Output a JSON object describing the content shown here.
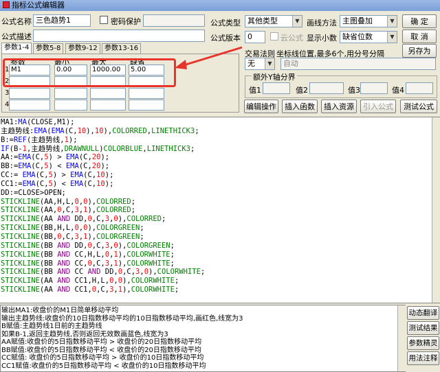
{
  "window": {
    "title": "指标公式编辑器"
  },
  "form": {
    "name_label": "公式名称",
    "name_value": "三色趋势1",
    "password_label": "密码保护",
    "desc_label": "公式描述",
    "type_label": "公式类型",
    "type_value": "其他类型",
    "draw_label": "画线方法",
    "draw_value": "主图叠加",
    "version_label": "公式版本",
    "version_value": "0",
    "cloud_label": "云公式",
    "decimals_label": "显示小数",
    "decimals_value": "缺省位数",
    "trade_label": "交易法则",
    "coord_label": "坐标线位置,最多6个,用分号分隔",
    "trade_value": "无",
    "coord_value": "自动"
  },
  "buttons": {
    "ok": "确 定",
    "cancel": "取 消",
    "save_as": "另存为",
    "edit_op": "编辑操作",
    "insert_fn": "插入函数",
    "insert_res": "插入资源",
    "import": "引入公式",
    "test": "测试公式"
  },
  "param_tabs": [
    "参数1-4",
    "参数5-8",
    "参数9-12",
    "参数13-16"
  ],
  "param_headers": [
    "参数",
    "最小",
    "最大",
    "缺省"
  ],
  "params": [
    {
      "row": "1",
      "name": "M1",
      "min": "0.00",
      "max": "1000.00",
      "def": "5.00"
    },
    {
      "row": "2",
      "name": "",
      "min": "",
      "max": "",
      "def": ""
    },
    {
      "row": "3",
      "name": "",
      "min": "",
      "max": "",
      "def": ""
    },
    {
      "row": "4",
      "name": "",
      "min": "",
      "max": "",
      "def": ""
    }
  ],
  "y_axis": {
    "title": "额外Y轴分界",
    "labels": [
      "值1",
      "值2",
      "值3",
      "值4"
    ]
  },
  "code_lines": [
    [
      [
        "MA1:",
        "op"
      ],
      [
        "MA",
        "fn"
      ],
      [
        "(CLOSE,M1);",
        "op"
      ]
    ],
    [
      [
        "主趋势线:",
        "op"
      ],
      [
        "EMA",
        "fn"
      ],
      [
        "(",
        "op"
      ],
      [
        "EMA",
        "fn"
      ],
      [
        "(C,",
        "op"
      ],
      [
        "10",
        "num"
      ],
      [
        "),",
        "op"
      ],
      [
        "10",
        "num"
      ],
      [
        "),",
        "op"
      ],
      [
        "COLORRED",
        "color"
      ],
      [
        ",",
        "op"
      ],
      [
        "LINETHICK3",
        "color"
      ],
      [
        ";",
        "op"
      ]
    ],
    [
      [
        "B:=",
        "op"
      ],
      [
        "REF",
        "fn"
      ],
      [
        "(主趋势线,",
        "op"
      ],
      [
        "1",
        "num"
      ],
      [
        ");",
        "op"
      ]
    ],
    [
      [
        "IF",
        "fn"
      ],
      [
        "(B-",
        "op"
      ],
      [
        "1",
        "num"
      ],
      [
        ",主趋势线,",
        "op"
      ],
      [
        "DRAWNULL",
        "color"
      ],
      [
        ")",
        "op"
      ],
      [
        "COLORBLUE",
        "color"
      ],
      [
        ",",
        "op"
      ],
      [
        "LINETHICK3",
        "color"
      ],
      [
        ";",
        "op"
      ]
    ],
    [
      [
        "AA:=",
        "op"
      ],
      [
        "EMA",
        "fn"
      ],
      [
        "(C,",
        "op"
      ],
      [
        "5",
        "num"
      ],
      [
        ") > ",
        "op"
      ],
      [
        "EMA",
        "fn"
      ],
      [
        "(C,",
        "op"
      ],
      [
        "20",
        "num"
      ],
      [
        ");",
        "op"
      ]
    ],
    [
      [
        "BB:=",
        "op"
      ],
      [
        "EMA",
        "fn"
      ],
      [
        "(C,",
        "op"
      ],
      [
        "5",
        "num"
      ],
      [
        ") < ",
        "op"
      ],
      [
        "EMA",
        "fn"
      ],
      [
        "(C,",
        "op"
      ],
      [
        "20",
        "num"
      ],
      [
        ");",
        "op"
      ]
    ],
    [
      [
        "CC:= ",
        "op"
      ],
      [
        "EMA",
        "fn"
      ],
      [
        "(C,",
        "op"
      ],
      [
        "5",
        "num"
      ],
      [
        ") > ",
        "op"
      ],
      [
        "EMA",
        "fn"
      ],
      [
        "(C,",
        "op"
      ],
      [
        "10",
        "num"
      ],
      [
        ");",
        "op"
      ]
    ],
    [
      [
        "CC1:=",
        "op"
      ],
      [
        "EMA",
        "fn"
      ],
      [
        "(C,",
        "op"
      ],
      [
        "5",
        "num"
      ],
      [
        ") < ",
        "op"
      ],
      [
        "EMA",
        "fn"
      ],
      [
        "(C,",
        "op"
      ],
      [
        "10",
        "num"
      ],
      [
        ");",
        "op"
      ]
    ],
    [
      [
        "DD:=",
        "op"
      ],
      [
        "CLOSE",
        "op"
      ],
      [
        ">",
        "op"
      ],
      [
        "OPEN",
        "op"
      ],
      [
        ";",
        "op"
      ]
    ],
    [
      [
        "STICKLINE",
        "color"
      ],
      [
        "(AA,H,L,",
        "op"
      ],
      [
        "0",
        "num"
      ],
      [
        ",",
        "op"
      ],
      [
        "0",
        "num"
      ],
      [
        "),",
        "op"
      ],
      [
        "COLORRED",
        "color"
      ],
      [
        ";",
        "op"
      ]
    ],
    [
      [
        "STICKLINE",
        "color"
      ],
      [
        "(AA,",
        "op"
      ],
      [
        "0",
        "num"
      ],
      [
        ",C,",
        "op"
      ],
      [
        "3",
        "num"
      ],
      [
        ",",
        "op"
      ],
      [
        "1",
        "num"
      ],
      [
        "),",
        "op"
      ],
      [
        "COLORRED",
        "color"
      ],
      [
        ";",
        "op"
      ]
    ],
    [
      [
        "STICKLINE",
        "color"
      ],
      [
        "(AA ",
        "op"
      ],
      [
        "AND",
        "kw"
      ],
      [
        " DD,",
        "op"
      ],
      [
        "0",
        "num"
      ],
      [
        ",C,",
        "op"
      ],
      [
        "3",
        "num"
      ],
      [
        ",",
        "op"
      ],
      [
        "0",
        "num"
      ],
      [
        "),",
        "op"
      ],
      [
        "COLORRED",
        "color"
      ],
      [
        ";",
        "op"
      ]
    ],
    [
      [
        "STICKLINE",
        "color"
      ],
      [
        "(BB,H,L,",
        "op"
      ],
      [
        "0",
        "num"
      ],
      [
        ",",
        "op"
      ],
      [
        "0",
        "num"
      ],
      [
        "),",
        "op"
      ],
      [
        "COLORGREEN",
        "color"
      ],
      [
        ";",
        "op"
      ]
    ],
    [
      [
        "STICKLINE",
        "color"
      ],
      [
        "(BB,",
        "op"
      ],
      [
        "0",
        "num"
      ],
      [
        ",C,",
        "op"
      ],
      [
        "3",
        "num"
      ],
      [
        ",",
        "op"
      ],
      [
        "1",
        "num"
      ],
      [
        "),",
        "op"
      ],
      [
        "COLORGREEN",
        "color"
      ],
      [
        ";",
        "op"
      ]
    ],
    [
      [
        "STICKLINE",
        "color"
      ],
      [
        "(BB ",
        "op"
      ],
      [
        "AND",
        "kw"
      ],
      [
        " DD,",
        "op"
      ],
      [
        "0",
        "num"
      ],
      [
        ",C,",
        "op"
      ],
      [
        "3",
        "num"
      ],
      [
        ",",
        "op"
      ],
      [
        "0",
        "num"
      ],
      [
        "),",
        "op"
      ],
      [
        "COLORGREEN",
        "color"
      ],
      [
        ";",
        "op"
      ]
    ],
    [
      [
        "STICKLINE",
        "color"
      ],
      [
        "(BB ",
        "op"
      ],
      [
        "AND",
        "kw"
      ],
      [
        " CC,H,L,",
        "op"
      ],
      [
        "0",
        "num"
      ],
      [
        ",",
        "op"
      ],
      [
        "1",
        "num"
      ],
      [
        "),",
        "op"
      ],
      [
        "COLORWHITE",
        "color"
      ],
      [
        ";",
        "op"
      ]
    ],
    [
      [
        "STICKLINE",
        "color"
      ],
      [
        "(BB ",
        "op"
      ],
      [
        "AND",
        "kw"
      ],
      [
        " CC,",
        "op"
      ],
      [
        "0",
        "num"
      ],
      [
        ",C,",
        "op"
      ],
      [
        "3",
        "num"
      ],
      [
        ",",
        "op"
      ],
      [
        "1",
        "num"
      ],
      [
        "),",
        "op"
      ],
      [
        "COLORWHITE",
        "color"
      ],
      [
        ";",
        "op"
      ]
    ],
    [
      [
        "STICKLINE",
        "color"
      ],
      [
        "(BB ",
        "op"
      ],
      [
        "AND",
        "kw"
      ],
      [
        " CC ",
        "op"
      ],
      [
        "AND",
        "kw"
      ],
      [
        " DD,",
        "op"
      ],
      [
        "0",
        "num"
      ],
      [
        ",C,",
        "op"
      ],
      [
        "3",
        "num"
      ],
      [
        ",",
        "op"
      ],
      [
        "0",
        "num"
      ],
      [
        "),",
        "op"
      ],
      [
        "COLORWHITE",
        "color"
      ],
      [
        ";",
        "op"
      ]
    ],
    [
      [
        "STICKLINE",
        "color"
      ],
      [
        "(AA ",
        "op"
      ],
      [
        "AND",
        "kw"
      ],
      [
        " CC1,H,L,",
        "op"
      ],
      [
        "0",
        "num"
      ],
      [
        ",",
        "op"
      ],
      [
        "0",
        "num"
      ],
      [
        "),",
        "op"
      ],
      [
        "COLORWHITE",
        "color"
      ],
      [
        ";",
        "op"
      ]
    ],
    [
      [
        "STICKLINE",
        "color"
      ],
      [
        "(AA ",
        "op"
      ],
      [
        "AND",
        "kw"
      ],
      [
        " CC1,",
        "op"
      ],
      [
        "0",
        "num"
      ],
      [
        ",C,",
        "op"
      ],
      [
        "3",
        "num"
      ],
      [
        ",",
        "op"
      ],
      [
        "1",
        "num"
      ],
      [
        "),",
        "op"
      ],
      [
        "COLORWHITE",
        "color"
      ],
      [
        ";",
        "op"
      ]
    ]
  ],
  "output_lines": [
    "输出MA1:收盘价的M1日简单移动平均",
    "输出主趋势线:收盘价的10日指数移动平均的10日指数移动平均,画红色,线宽为3",
    "B赋值:主趋势线1日前的主趋势线",
    "如果B-1,返回主趋势线,否则返回无效数画蓝色,线宽为3",
    "AA赋值:收盘价的5日指数移动平均 > 收盘价的20日指数移动平均",
    "BB赋值:收盘价的5日指数移动平均 < 收盘价的20日指数移动平均",
    "CC赋值: 收盘价的5日指数移动平均 > 收盘价的10日指数移动平均",
    "CC1赋值:收盘价的5日指数移动平均 < 收盘价的10日指数移动平均"
  ],
  "side_buttons": [
    "动态翻译",
    "测试结果",
    "参数精灵",
    "用法注释"
  ],
  "colors": {
    "highlight": "#e8332b",
    "function": "#0000ff",
    "number": "#ff0000",
    "constant": "#008000",
    "keyword": "#8b008b"
  }
}
